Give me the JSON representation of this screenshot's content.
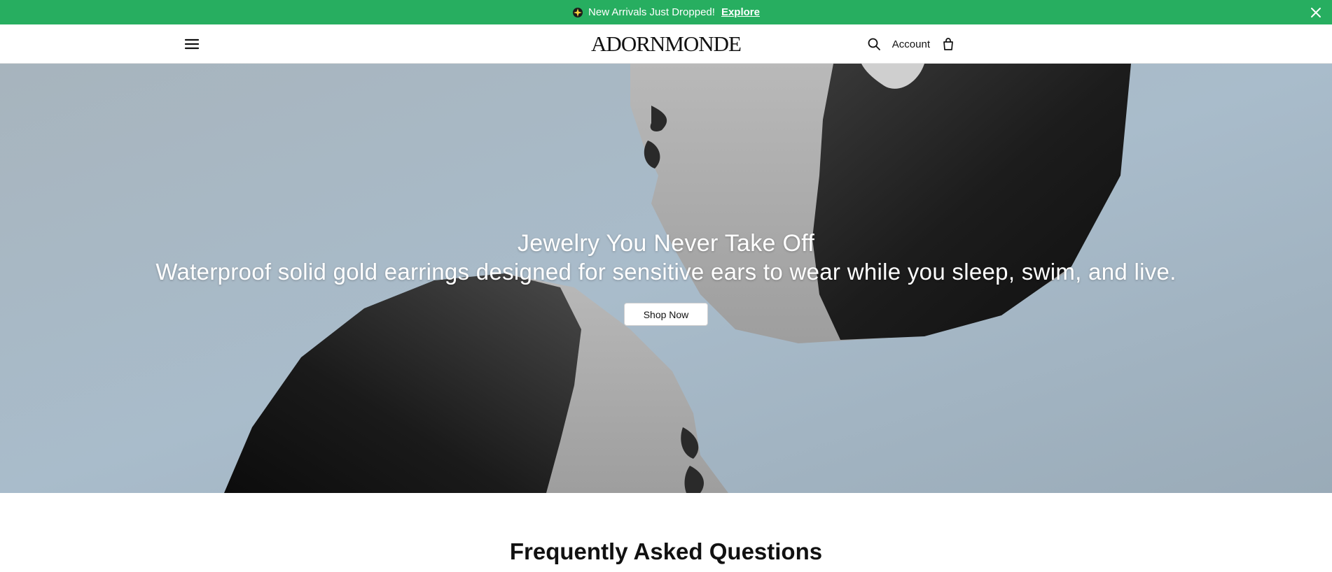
{
  "announcement": {
    "text": "New Arrivals Just Dropped!",
    "link_label": "Explore",
    "background": "#27ae60",
    "leading_icon": "sparkle-icon",
    "close_icon": "close-icon"
  },
  "header": {
    "menu_icon": "hamburger-menu-icon",
    "logo": "ADORNMONDE",
    "search_icon": "search-icon",
    "account_label": "Account",
    "cart_icon": "shopping-bag-icon"
  },
  "hero": {
    "heading": "Jewelry You Never Take Off",
    "subheading": "Waterproof solid gold earrings designed for sensitive ears to wear while you sleep, swim, and live.",
    "cta_label": "Shop Now",
    "image": "vintage black-and-white photo of two faces with slicked hair"
  },
  "faq": {
    "title": "Frequently Asked Questions"
  }
}
